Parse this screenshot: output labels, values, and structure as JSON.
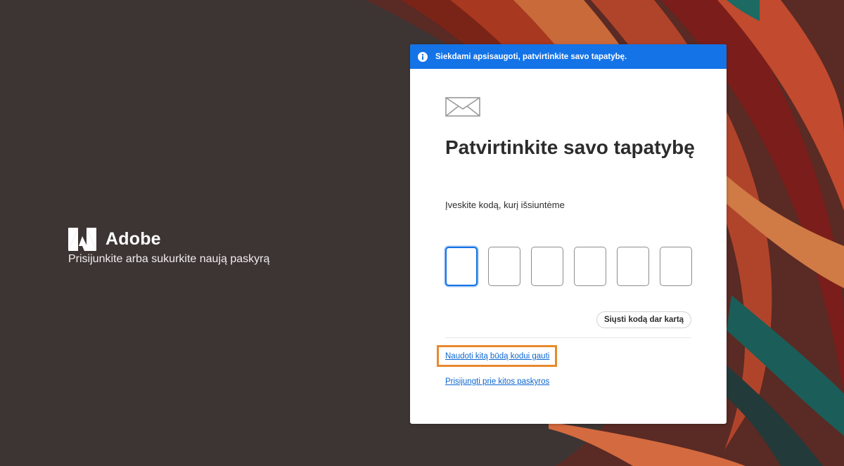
{
  "brand": {
    "name": "Adobe",
    "tagline": "Prisijunkite arba sukurkite naują paskyrą"
  },
  "banner": {
    "icon": "info-icon",
    "text": "Siekdami apsisaugoti, patvirtinkite savo tapatybę.",
    "color": "#1473e6"
  },
  "card": {
    "icon": "envelope-icon",
    "title": "Patvirtinkite savo tapatybę",
    "subtitle": "Įveskite kodą, kurį išsiuntėme",
    "code_digits": [
      "",
      "",
      "",
      "",
      "",
      ""
    ],
    "resend_label": "Siųsti kodą dar kartą",
    "alt_method_link": "Naudoti kitą būdą kodui gauti",
    "other_account_link": "Prisijungti prie kitos paskyros",
    "highlight_color": "#e9892f"
  }
}
